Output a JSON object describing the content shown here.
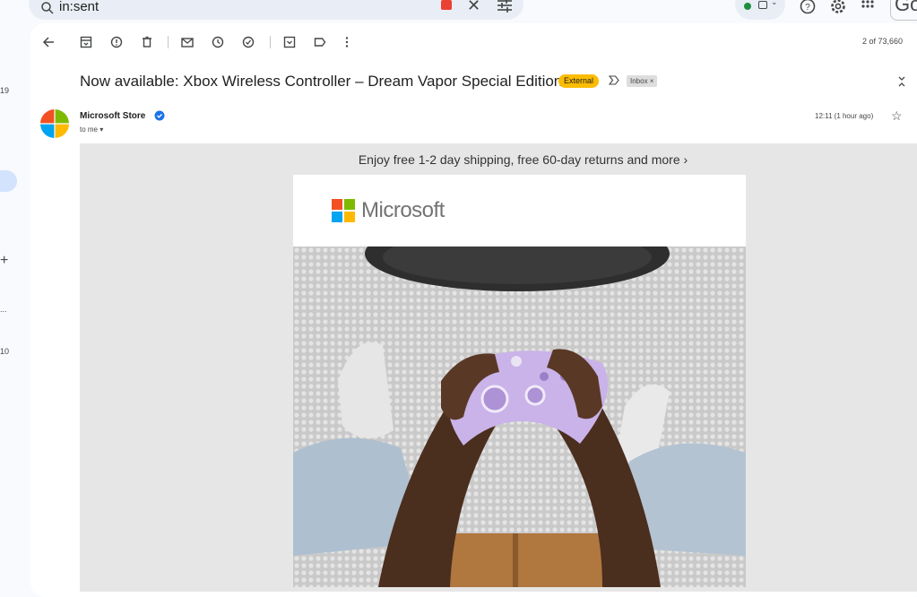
{
  "search": {
    "query": "in:sent"
  },
  "header": {
    "google_partial": "Go"
  },
  "left_rail": {
    "counts": [
      "19",
      "10"
    ],
    "ellipsis": "..."
  },
  "toolbar": {
    "page_count": "2 of 73,660"
  },
  "message": {
    "subject": "Now available: Xbox Wireless Controller – Dream Vapor Special Edition",
    "external_label": "External",
    "inbox_label": "Inbox ×",
    "sender": "Microsoft Store",
    "recipient": "to me",
    "time": "12:11 (1 hour ago)"
  },
  "email": {
    "promo_text": "Enjoy free 1-2 day shipping, free 60-day returns and more ›",
    "brand": "Microsoft"
  },
  "colors": {
    "accent": "#d3e3fd",
    "external_badge": "#fbbc04",
    "ms_red": "#f25022",
    "ms_green": "#7fba00",
    "ms_blue": "#00a4ef",
    "ms_yellow": "#ffb900",
    "controller": "#c9b3e8"
  }
}
